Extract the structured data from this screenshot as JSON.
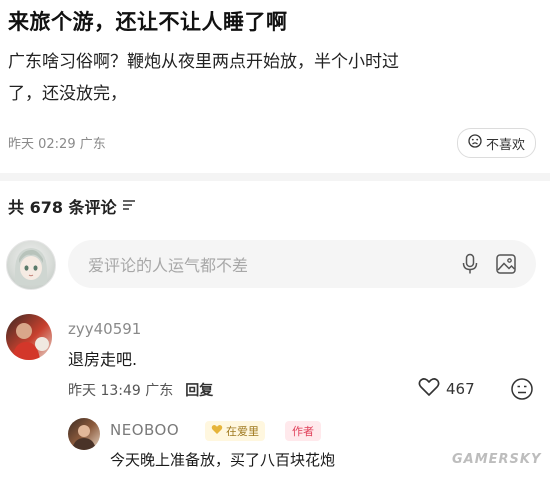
{
  "post": {
    "title": "来旅个游，还让不让人睡了啊",
    "body_line1": "广东啥习俗啊？鞭炮从夜里两点开始放，半个小时过",
    "body_line2": "了，还没放完，",
    "meta": "昨天 02:29 广东",
    "dislike_label": "不喜欢"
  },
  "comments_header": {
    "count_label": "共 678 条评论"
  },
  "input": {
    "placeholder": "爱评论的人运气都不差"
  },
  "comments": [
    {
      "user": "zyy40591",
      "text": "退房走吧.",
      "time_location": "昨天 13:49 广东",
      "reply_label": "回复",
      "likes": "467",
      "replies": [
        {
          "user": "NEOBOO",
          "badge_love": "在爱里",
          "badge_author": "作者",
          "text": "今天晚上准备放，买了八百块花炮"
        }
      ]
    }
  ],
  "watermark": "GAMERSKY",
  "colors": {
    "author_badge": "#e0405a",
    "love_badge": "#a07a20",
    "meta_gray": "#8a8a8a"
  }
}
